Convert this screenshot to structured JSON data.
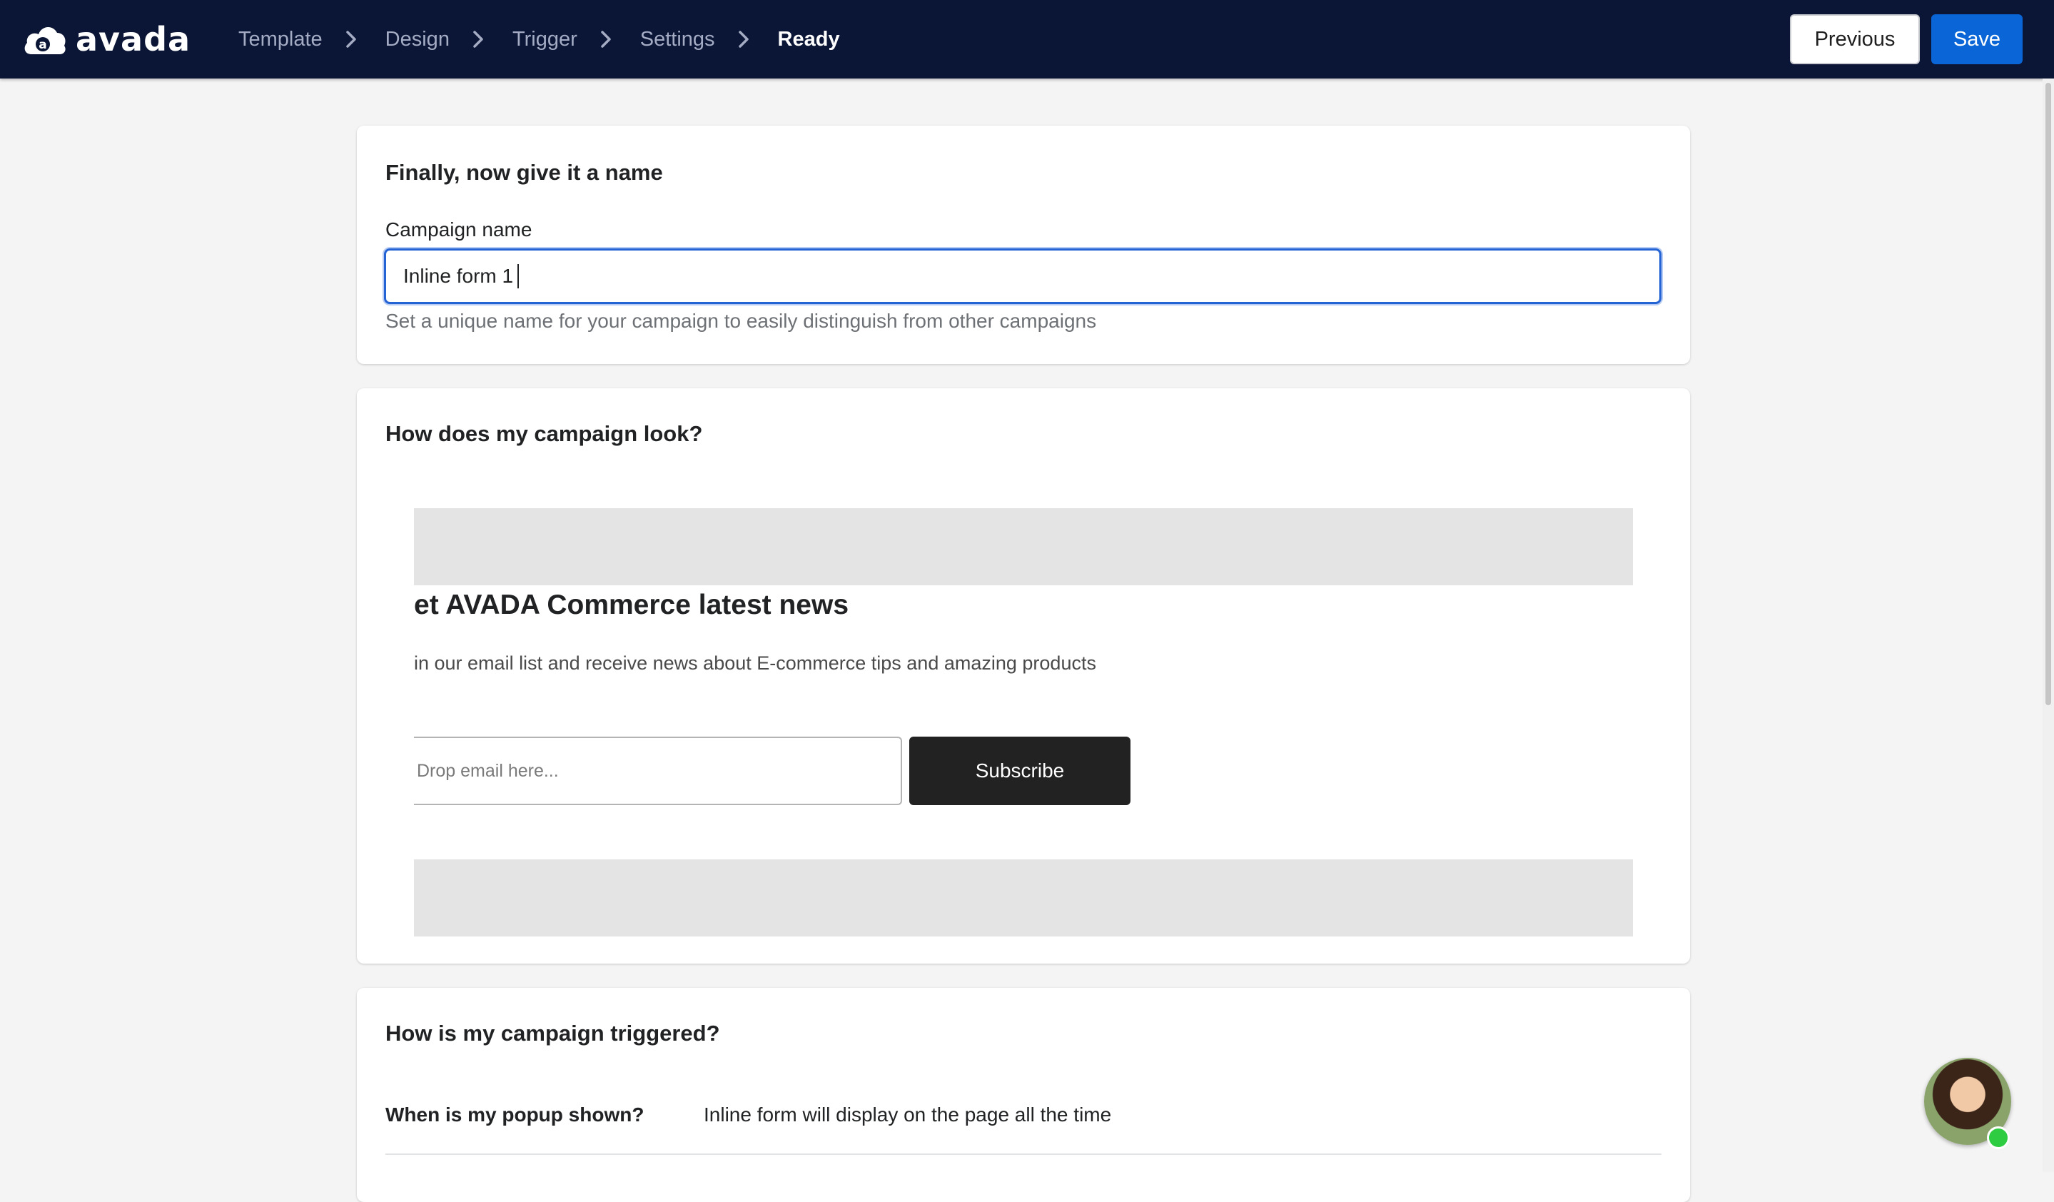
{
  "brand": {
    "name": "avada",
    "logo_icon": "cloud-logo-icon"
  },
  "steps": [
    {
      "label": "Template"
    },
    {
      "label": "Design"
    },
    {
      "label": "Trigger"
    },
    {
      "label": "Settings"
    },
    {
      "label": "Ready",
      "active": true
    }
  ],
  "actions": {
    "previous": "Previous",
    "save": "Save"
  },
  "name_card": {
    "title": "Finally, now give it a name",
    "field_label": "Campaign name",
    "value": "Inline form 1",
    "help": "Set a unique name for your campaign to easily distinguish from other campaigns"
  },
  "preview_card": {
    "title": "How does my campaign look?",
    "preview_title": "et AVADA Commerce latest news",
    "preview_subtitle": "in our email list and receive news about E-commerce tips and amazing products",
    "email_placeholder": "Drop email here...",
    "subscribe_label": "Subscribe"
  },
  "trigger_card": {
    "title": "How is my campaign triggered?",
    "rows": [
      {
        "label": "When is my popup shown?",
        "value": "Inline form will display on the page all the time"
      }
    ]
  },
  "colors": {
    "nav_bg": "#0b1536",
    "primary": "#0a66d6",
    "focus": "#2463d4",
    "online": "#2ecc40"
  }
}
